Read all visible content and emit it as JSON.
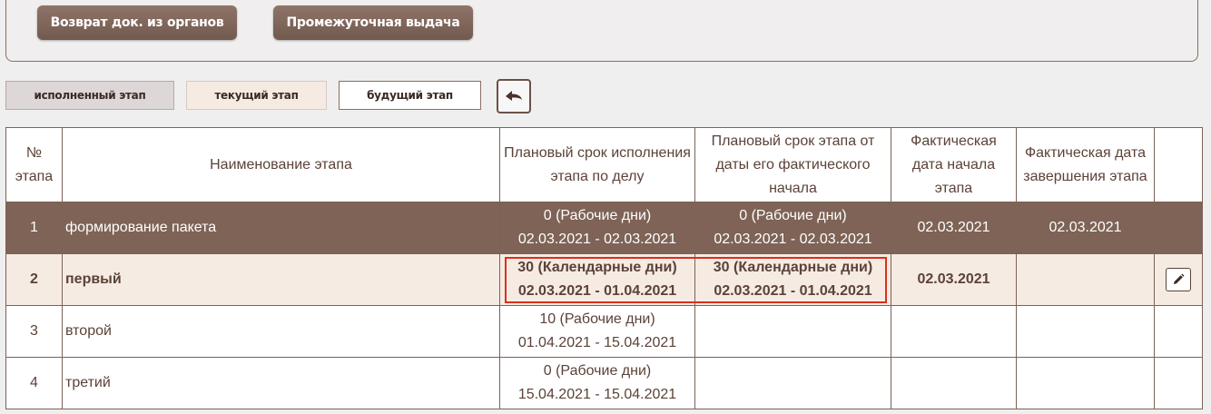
{
  "toolbar": {
    "return_docs_label": "Возврат док. из органов",
    "interim_issue_label": "Промежуточная выдача"
  },
  "legend": {
    "done": "исполненный этап",
    "current": "текущий этап",
    "future": "будущий этап"
  },
  "table": {
    "headers": {
      "num": "№ этапа",
      "name": "Наименование этапа",
      "plan_case": "Плановый срок исполнения этапа по делу",
      "plan_actual": "Плановый срок этапа от даты его фактического начала",
      "fact_start": "Фактическая дата начала этапа",
      "fact_end": "Фактическая дата завершения этапа"
    },
    "rows": [
      {
        "num": "1",
        "name": "формирование пакета",
        "plan_case_dur": "0 (Рабочие дни)",
        "plan_case_range": "02.03.2021 - 02.03.2021",
        "plan_actual_dur": "0 (Рабочие дни)",
        "plan_actual_range": "02.03.2021 - 02.03.2021",
        "fact_start": "02.03.2021",
        "fact_end": "02.03.2021"
      },
      {
        "num": "2",
        "name": "первый",
        "plan_case_dur": "30 (Календарные дни)",
        "plan_case_range": "02.03.2021 - 01.04.2021",
        "plan_actual_dur": "30 (Календарные дни)",
        "plan_actual_range": "02.03.2021 - 01.04.2021",
        "fact_start": "02.03.2021",
        "fact_end": ""
      },
      {
        "num": "3",
        "name": "второй",
        "plan_case_dur": "10 (Рабочие дни)",
        "plan_case_range": "01.04.2021 - 15.04.2021",
        "plan_actual_dur": "",
        "plan_actual_range": "",
        "fact_start": "",
        "fact_end": ""
      },
      {
        "num": "4",
        "name": "третий",
        "plan_case_dur": "0 (Рабочие дни)",
        "plan_case_range": "15.04.2021 - 15.04.2021",
        "plan_actual_dur": "",
        "plan_actual_range": "",
        "fact_start": "",
        "fact_end": ""
      }
    ]
  },
  "icons": {
    "back": "back-arrow-icon",
    "edit": "pencil-icon"
  },
  "colors": {
    "button": "#7a6053",
    "done_row": "#7e6356",
    "current_row": "#f6ebe3",
    "highlight": "#d9301c"
  }
}
